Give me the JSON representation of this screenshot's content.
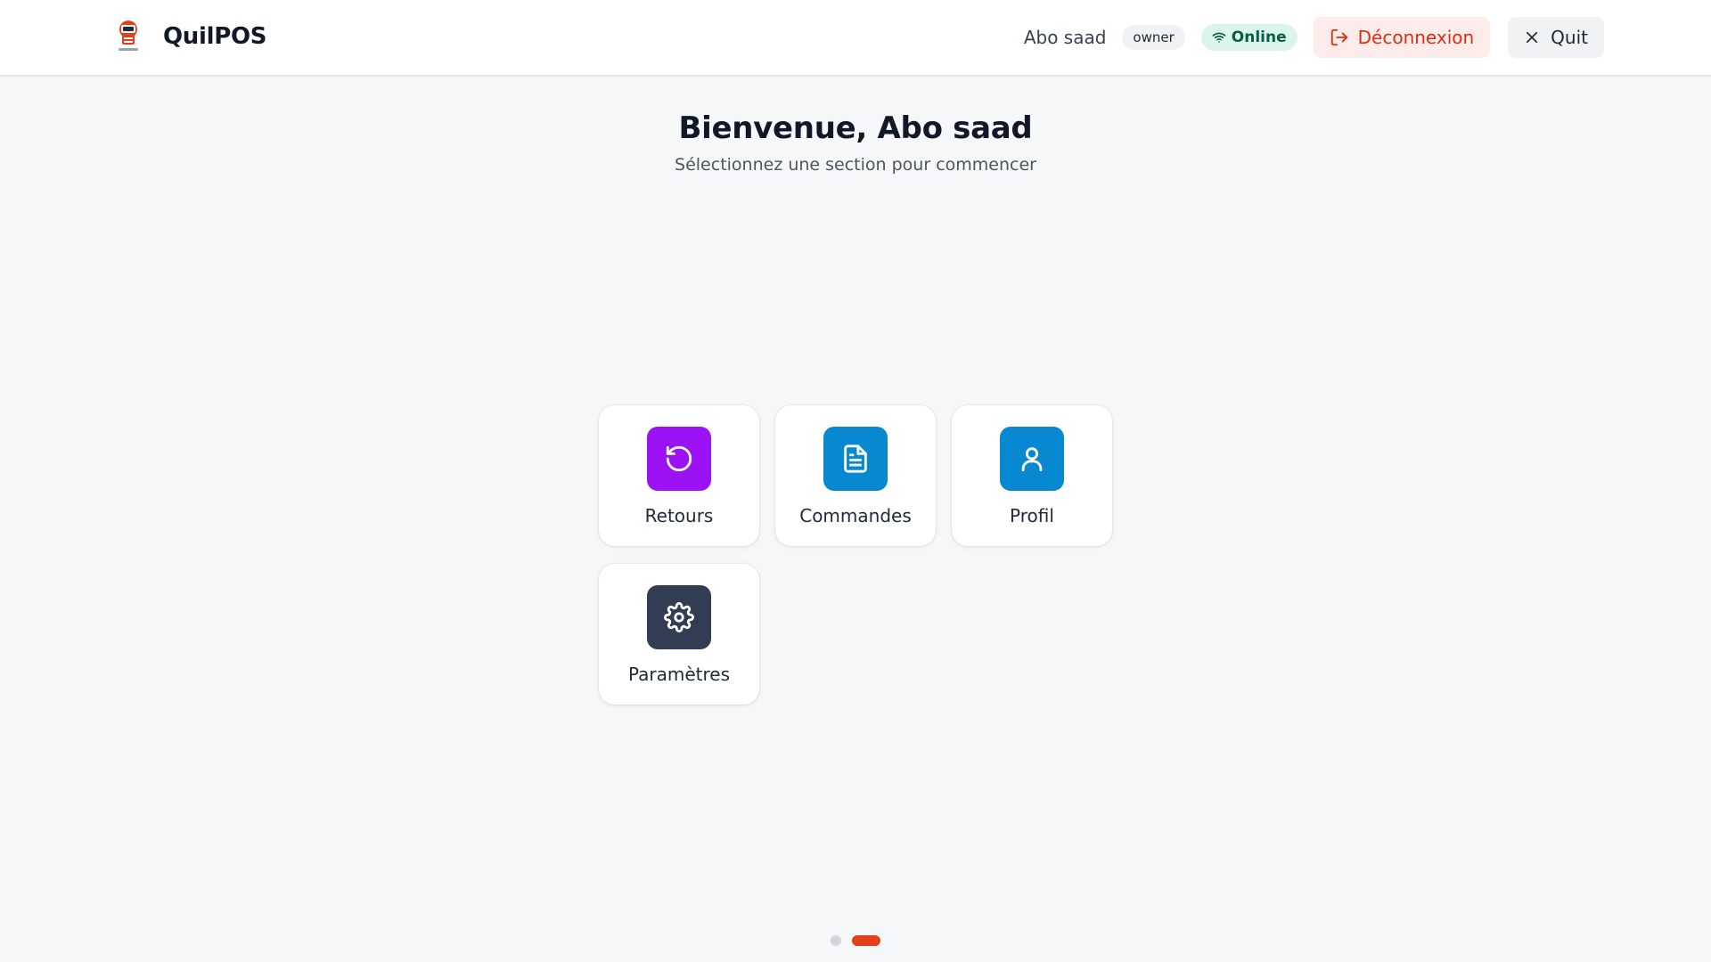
{
  "app": {
    "name": "QuilPOS"
  },
  "header": {
    "user_name": "Abo saad",
    "role": "owner",
    "status": "Online",
    "logout_label": "Déconnexion",
    "quit_label": "Quit"
  },
  "welcome": {
    "title": "Bienvenue, Abo saad",
    "subtitle": "Sélectionnez une section pour commencer"
  },
  "sections": [
    {
      "label": "Retours",
      "icon": "rotate-ccw-icon",
      "color": "#9b12f5"
    },
    {
      "label": "Commandes",
      "icon": "file-text-icon",
      "color": "#0888d1"
    },
    {
      "label": "Profil",
      "icon": "user-icon",
      "color": "#0888d1"
    },
    {
      "label": "Paramètres",
      "icon": "settings-gear-icon",
      "color": "#323c52"
    }
  ],
  "pagination": {
    "total": 2,
    "active": 2
  },
  "colors": {
    "accent": "#e2401b",
    "logout_text": "#dc2f10",
    "logout_bg": "#fdecea",
    "online_text": "#065f46",
    "online_bg": "#dcf5ea"
  }
}
